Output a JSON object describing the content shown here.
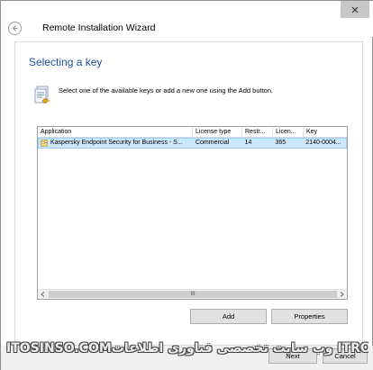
{
  "window": {
    "title": "Remote Installation Wizard"
  },
  "page": {
    "heading": "Selecting a key",
    "instruction": "Select one of the available keys or add a new one using the Add button."
  },
  "list": {
    "columns": [
      "Application",
      "License type",
      "Restr...",
      "Licen...",
      "Key"
    ],
    "rows": [
      {
        "application": "Kaspersky Endpoint Security for Business - S...",
        "license_type": "Commercial",
        "restr": "14",
        "licen": "365",
        "key": "2140-0004..."
      }
    ],
    "scrollbar_grip": "III"
  },
  "buttons": {
    "add": "Add",
    "properties": "Properties",
    "next": "Next",
    "cancel": "Cancel"
  },
  "watermark": {
    "left": "ITOSINSO.COM",
    "right": "وب سایت تخصصی فناوری اطلاعات ITRO.ir"
  },
  "icons": {
    "back": "back-arrow-icon",
    "close": "close-icon",
    "document": "key-document-icon",
    "key": "key-icon"
  },
  "colors": {
    "heading": "#1f4e9a",
    "selected_row": "#cce8ff",
    "close_button": "#c7c7c7"
  }
}
